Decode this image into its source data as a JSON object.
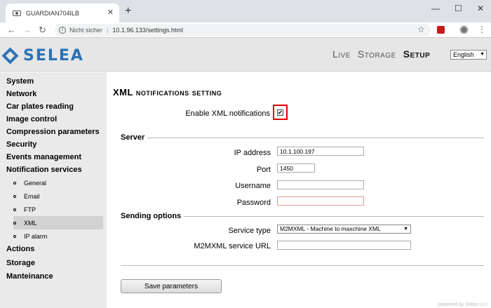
{
  "browser": {
    "tab_title": "GUARDIAN704ILB",
    "tab_close": "✕",
    "new_tab": "+",
    "security_label": "Nicht sicher",
    "url": "10.1.96.133/settings.html"
  },
  "header": {
    "logo_text": "SELEA",
    "nav": [
      "Live",
      "Storage",
      "Setup"
    ],
    "active_nav": "Setup",
    "language": "English"
  },
  "sidebar": {
    "items": [
      "System",
      "Network",
      "Car plates reading",
      "Image control",
      "Compression parameters",
      "Security",
      "Events management",
      "Notification services"
    ],
    "subitems": [
      "General",
      "Email",
      "FTP",
      "XML",
      "IP alarm"
    ],
    "selected_subitem": "XML",
    "items_after": [
      "Actions",
      "Storage",
      "Manteinance"
    ]
  },
  "main": {
    "title": "XML notifications setting",
    "enable_label": "Enable XML notifications",
    "enable_checked": true,
    "server_section": "Server",
    "ip_label": "IP address",
    "ip_value": "10.1.100.197",
    "port_label": "Port",
    "port_value": "1450",
    "username_label": "Username",
    "username_value": "",
    "password_label": "Password",
    "password_value": "",
    "sending_section": "Sending options",
    "service_type_label": "Service type",
    "service_type_value": "M2MXML - Machine to maxchine XML",
    "service_url_label": "M2MXML service URL",
    "service_url_value": "",
    "save_button": "Save parameters",
    "powered_by": "powered by Selea s.r.l."
  },
  "colors": {
    "brand": "#2b73b6",
    "highlight_border": "#e00000"
  }
}
